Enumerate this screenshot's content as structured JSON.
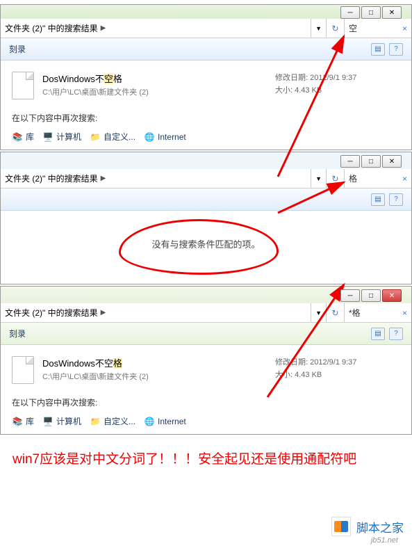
{
  "panel1": {
    "breadcrumb": "文件夹 (2)\" 中的搜索结果",
    "search_value": "空",
    "toolbar_label": "刻录",
    "file": {
      "name_pre": "DosWindows不",
      "name_hl": "空",
      "name_post": "格",
      "path": "C:\\用户\\LC\\桌面\\新建文件夹 (2)",
      "meta_date_label": "修改日期:",
      "meta_date": "2012/9/1 9:37",
      "meta_size_label": "大小:",
      "meta_size": "4.43 KB"
    },
    "search_again_label": "在以下内容中再次搜索:",
    "locations": {
      "lib": "库",
      "computer": "计算机",
      "custom": "自定义...",
      "internet": "Internet"
    }
  },
  "panel2": {
    "breadcrumb": "文件夹 (2)\" 中的搜索结果",
    "search_value": "格",
    "empty_message": "没有与搜索条件匹配的项。"
  },
  "panel3": {
    "breadcrumb": "文件夹 (2)\" 中的搜索结果",
    "search_value": "*格",
    "toolbar_label": "刻录",
    "file": {
      "name_pre": "DosWindows不空",
      "name_hl": "格",
      "name_post": "",
      "path": "C:\\用户\\LC\\桌面\\新建文件夹 (2)",
      "meta_date_label": "修改日期:",
      "meta_date": "2012/9/1 9:37",
      "meta_size_label": "大小:",
      "meta_size": "4.43 KB"
    },
    "search_again_label": "在以下内容中再次搜索:",
    "locations": {
      "lib": "库",
      "computer": "计算机",
      "custom": "自定义...",
      "internet": "Internet"
    }
  },
  "bottom_annotation": "win7应该是对中文分词了！！！安全起见还是使用通配符吧",
  "footer": {
    "brand": "脚本之家",
    "sub": "jb51.net"
  },
  "colors": {
    "annotation_red": "#ee0000",
    "highlight_yellow": "#fff2a8",
    "link_blue": "#2070c0"
  }
}
